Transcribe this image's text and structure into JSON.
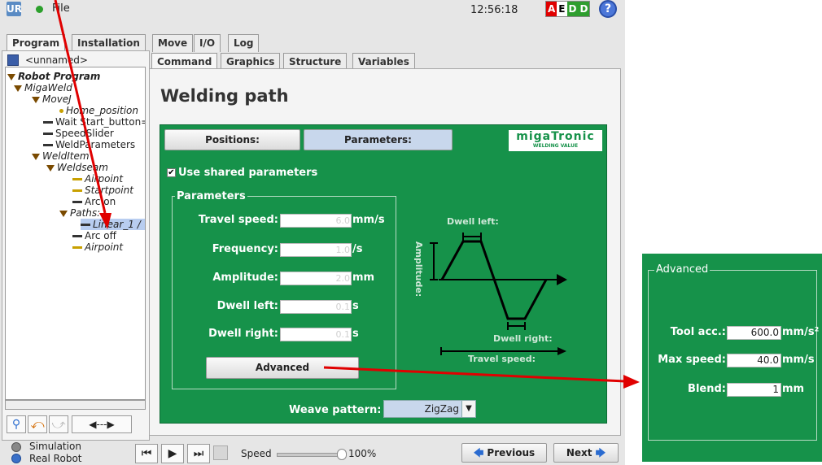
{
  "topbar": {
    "file_label": "File",
    "time": "12:56:18",
    "aedd": [
      "A",
      "E",
      "D",
      "D"
    ],
    "aedd_colors": [
      "#e00000",
      "#000000",
      "#2e9e2e",
      "#2e9e2e"
    ],
    "help_label": "?"
  },
  "main_tabs": [
    "Program",
    "Installation",
    "Move",
    "I/O",
    "Log"
  ],
  "program_name": "<unnamed>",
  "sub_tabs": [
    "Command",
    "Graphics",
    "Structure",
    "Variables"
  ],
  "tree": [
    "Robot Program",
    "MigaWeld",
    "MoveJ",
    "Home_position",
    "Wait Start_button=H",
    "SpeedSlider",
    "WeldParameters",
    "WeldItem",
    "Weldseam",
    "Airpoint",
    "Startpoint",
    "Arc on",
    "Paths:",
    "Linear_1 /",
    "Arc off",
    "Airpoint"
  ],
  "page_title": "Welding path",
  "positions_label": "Positions:",
  "parameters_label": "Parameters:",
  "brand": {
    "name": "migaTronic",
    "tagline": "WELDING VALUE"
  },
  "use_shared": {
    "label": "Use shared parameters",
    "checked": true
  },
  "params_group": "Parameters",
  "params": [
    {
      "label": "Travel speed:",
      "value": "6.0",
      "unit": "mm/s"
    },
    {
      "label": "Frequency:",
      "value": "1.0",
      "unit": "/s"
    },
    {
      "label": "Amplitude:",
      "value": "2.0",
      "unit": "mm"
    },
    {
      "label": "Dwell left:",
      "value": "0.1",
      "unit": "s"
    },
    {
      "label": "Dwell right:",
      "value": "0.1",
      "unit": "s"
    }
  ],
  "advanced_button": "Advanced",
  "diagram": {
    "dwell_left": "Dwell left:",
    "dwell_right": "Dwell right:",
    "amplitude": "Amplitude:",
    "travel_speed": "Travel speed:"
  },
  "weave": {
    "label": "Weave pattern:",
    "value": "ZigZag"
  },
  "bottom": {
    "simulation": "Simulation",
    "real_robot": "Real Robot",
    "speed_label": "Speed",
    "speed_value": "100%",
    "speed_fraction": 1.0,
    "previous": "Previous",
    "next": "Next"
  },
  "advanced_panel": {
    "title": "Advanced",
    "rows": [
      {
        "label": "Tool acc.:",
        "value": "600.0",
        "unit": "mm/s²"
      },
      {
        "label": "Max speed:",
        "value": "40.0",
        "unit": "mm/s"
      },
      {
        "label": "Blend:",
        "value": "1",
        "unit": "mm"
      }
    ]
  },
  "colors": {
    "weld_green": "#16924a",
    "arrow_red": "#e00000"
  }
}
